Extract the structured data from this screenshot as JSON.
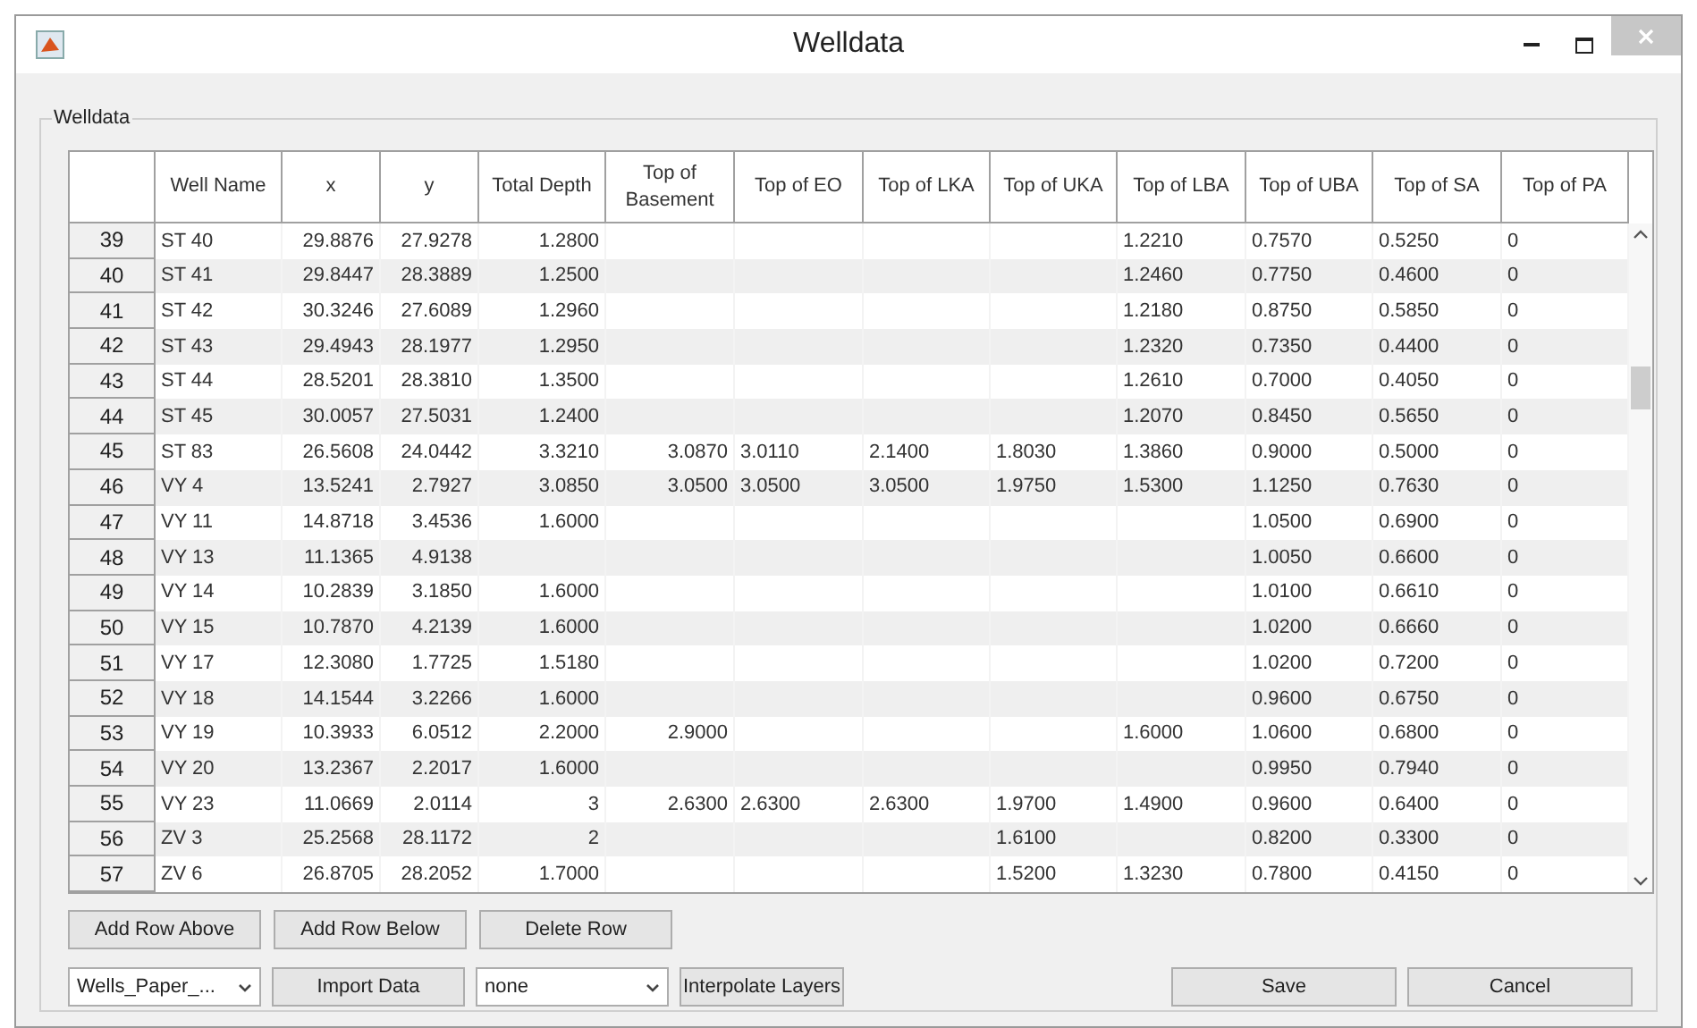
{
  "window": {
    "title": "Welldata"
  },
  "panel": {
    "title": "Welldata"
  },
  "table": {
    "columns": [
      "Well Name",
      "x",
      "y",
      "Total Depth",
      "Top of Basement",
      "Top of EO",
      "Top of LKA",
      "Top of UKA",
      "Top of LBA",
      "Top of UBA",
      "Top of SA",
      "Top of PA"
    ],
    "rows": [
      {
        "number": "39",
        "cells": [
          "ST 40",
          "29.8876",
          "27.9278",
          "1.2800",
          null,
          null,
          null,
          null,
          "1.2210",
          "0.7570",
          "0.5250",
          "0"
        ]
      },
      {
        "number": "40",
        "cells": [
          "ST 41",
          "29.8447",
          "28.3889",
          "1.2500",
          null,
          null,
          null,
          null,
          "1.2460",
          "0.7750",
          "0.4600",
          "0"
        ]
      },
      {
        "number": "41",
        "cells": [
          "ST 42",
          "30.3246",
          "27.6089",
          "1.2960",
          null,
          null,
          null,
          null,
          "1.2180",
          "0.8750",
          "0.5850",
          "0"
        ]
      },
      {
        "number": "42",
        "cells": [
          "ST 43",
          "29.4943",
          "28.1977",
          "1.2950",
          null,
          null,
          null,
          null,
          "1.2320",
          "0.7350",
          "0.4400",
          "0"
        ]
      },
      {
        "number": "43",
        "cells": [
          "ST 44",
          "28.5201",
          "28.3810",
          "1.3500",
          null,
          null,
          null,
          null,
          "1.2610",
          "0.7000",
          "0.4050",
          "0"
        ]
      },
      {
        "number": "44",
        "cells": [
          "ST 45",
          "30.0057",
          "27.5031",
          "1.2400",
          null,
          null,
          null,
          null,
          "1.2070",
          "0.8450",
          "0.5650",
          "0"
        ]
      },
      {
        "number": "45",
        "cells": [
          "ST 83",
          "26.5608",
          "24.0442",
          "3.3210",
          "3.0870",
          "3.0110",
          "2.1400",
          "1.8030",
          "1.3860",
          "0.9000",
          "0.5000",
          "0"
        ]
      },
      {
        "number": "46",
        "cells": [
          "VY 4",
          "13.5241",
          "2.7927",
          "3.0850",
          "3.0500",
          "3.0500",
          "3.0500",
          "1.9750",
          "1.5300",
          "1.1250",
          "0.7630",
          "0"
        ]
      },
      {
        "number": "47",
        "cells": [
          "VY 11",
          "14.8718",
          "3.4536",
          "1.6000",
          null,
          null,
          null,
          null,
          null,
          "1.0500",
          "0.6900",
          "0"
        ]
      },
      {
        "number": "48",
        "cells": [
          "VY 13",
          "11.1365",
          "4.9138",
          null,
          null,
          null,
          null,
          null,
          null,
          "1.0050",
          "0.6600",
          "0"
        ]
      },
      {
        "number": "49",
        "cells": [
          "VY 14",
          "10.2839",
          "3.1850",
          "1.6000",
          null,
          null,
          null,
          null,
          null,
          "1.0100",
          "0.6610",
          "0"
        ]
      },
      {
        "number": "50",
        "cells": [
          "VY 15",
          "10.7870",
          "4.2139",
          "1.6000",
          null,
          null,
          null,
          null,
          null,
          "1.0200",
          "0.6660",
          "0"
        ]
      },
      {
        "number": "51",
        "cells": [
          "VY 17",
          "12.3080",
          "1.7725",
          "1.5180",
          null,
          null,
          null,
          null,
          null,
          "1.0200",
          "0.7200",
          "0"
        ]
      },
      {
        "number": "52",
        "cells": [
          "VY 18",
          "14.1544",
          "3.2266",
          "1.6000",
          null,
          null,
          null,
          null,
          null,
          "0.9600",
          "0.6750",
          "0"
        ]
      },
      {
        "number": "53",
        "cells": [
          "VY 19",
          "10.3933",
          "6.0512",
          "2.2000",
          "2.9000",
          null,
          null,
          null,
          "1.6000",
          "1.0600",
          "0.6800",
          "0"
        ]
      },
      {
        "number": "54",
        "cells": [
          "VY 20",
          "13.2367",
          "2.2017",
          "1.6000",
          null,
          null,
          null,
          null,
          null,
          "0.9950",
          "0.7940",
          "0"
        ]
      },
      {
        "number": "55",
        "cells": [
          "VY 23",
          "11.0669",
          "2.0114",
          "3",
          "2.6300",
          "2.6300",
          "2.6300",
          "1.9700",
          "1.4900",
          "0.9600",
          "0.6400",
          "0"
        ]
      },
      {
        "number": "56",
        "cells": [
          "ZV 3",
          "25.2568",
          "28.1172",
          "2",
          null,
          null,
          null,
          "1.6100",
          null,
          "0.8200",
          "0.3300",
          "0"
        ]
      },
      {
        "number": "57",
        "cells": [
          "ZV 6",
          "26.8705",
          "28.2052",
          "1.7000",
          null,
          null,
          null,
          "1.5200",
          "1.3230",
          "0.7800",
          "0.4150",
          "0"
        ]
      }
    ]
  },
  "row_buttons": [
    "Add Row Above",
    "Add Row Below",
    "Delete Row"
  ],
  "file_dropdown": {
    "value": "Wells_Paper_..."
  },
  "import_button": "Import Data",
  "method_dropdown": {
    "value": "none"
  },
  "interpolate_button": "Interpolate Layers",
  "save_button": "Save",
  "cancel_button": "Cancel"
}
